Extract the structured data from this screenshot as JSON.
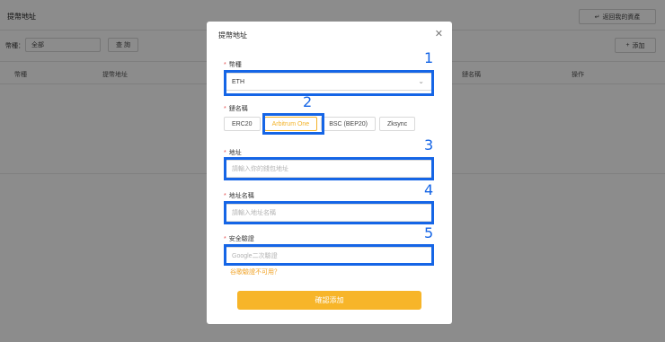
{
  "page": {
    "title": "提幣地址",
    "back_button": "返回我的資產",
    "filter_label": "幣種：",
    "filter_value": "全部",
    "query_button": "查 詢",
    "add_button": "添加",
    "columns": [
      "幣種",
      "提幣地址",
      "鏈名稱",
      "操作"
    ]
  },
  "modal": {
    "title": "提幣地址",
    "currency": {
      "label": "幣種",
      "value": "ETH"
    },
    "network": {
      "label": "鏈名稱",
      "options": [
        "ERC20",
        "Arbitrum One",
        "BSC (BEP20)",
        "Zksync"
      ],
      "selected": "Arbitrum One"
    },
    "address": {
      "label": "地址",
      "placeholder": "請輸入你的錢包地址"
    },
    "address_name": {
      "label": "地址名稱",
      "placeholder": "請輸入地址名稱"
    },
    "security": {
      "label": "安全驗證",
      "placeholder": "Google二次驗證"
    },
    "unavailable_link": "谷歌驗證不可用？",
    "submit": "確認添加"
  },
  "annotations": [
    "1",
    "2",
    "3",
    "4",
    "5"
  ],
  "colors": {
    "accent": "#f7b529",
    "highlight": "#1565e6",
    "required": "#e34d4d"
  },
  "icons": [
    "close-icon",
    "chevron-down-icon",
    "return-icon",
    "plus-icon"
  ]
}
